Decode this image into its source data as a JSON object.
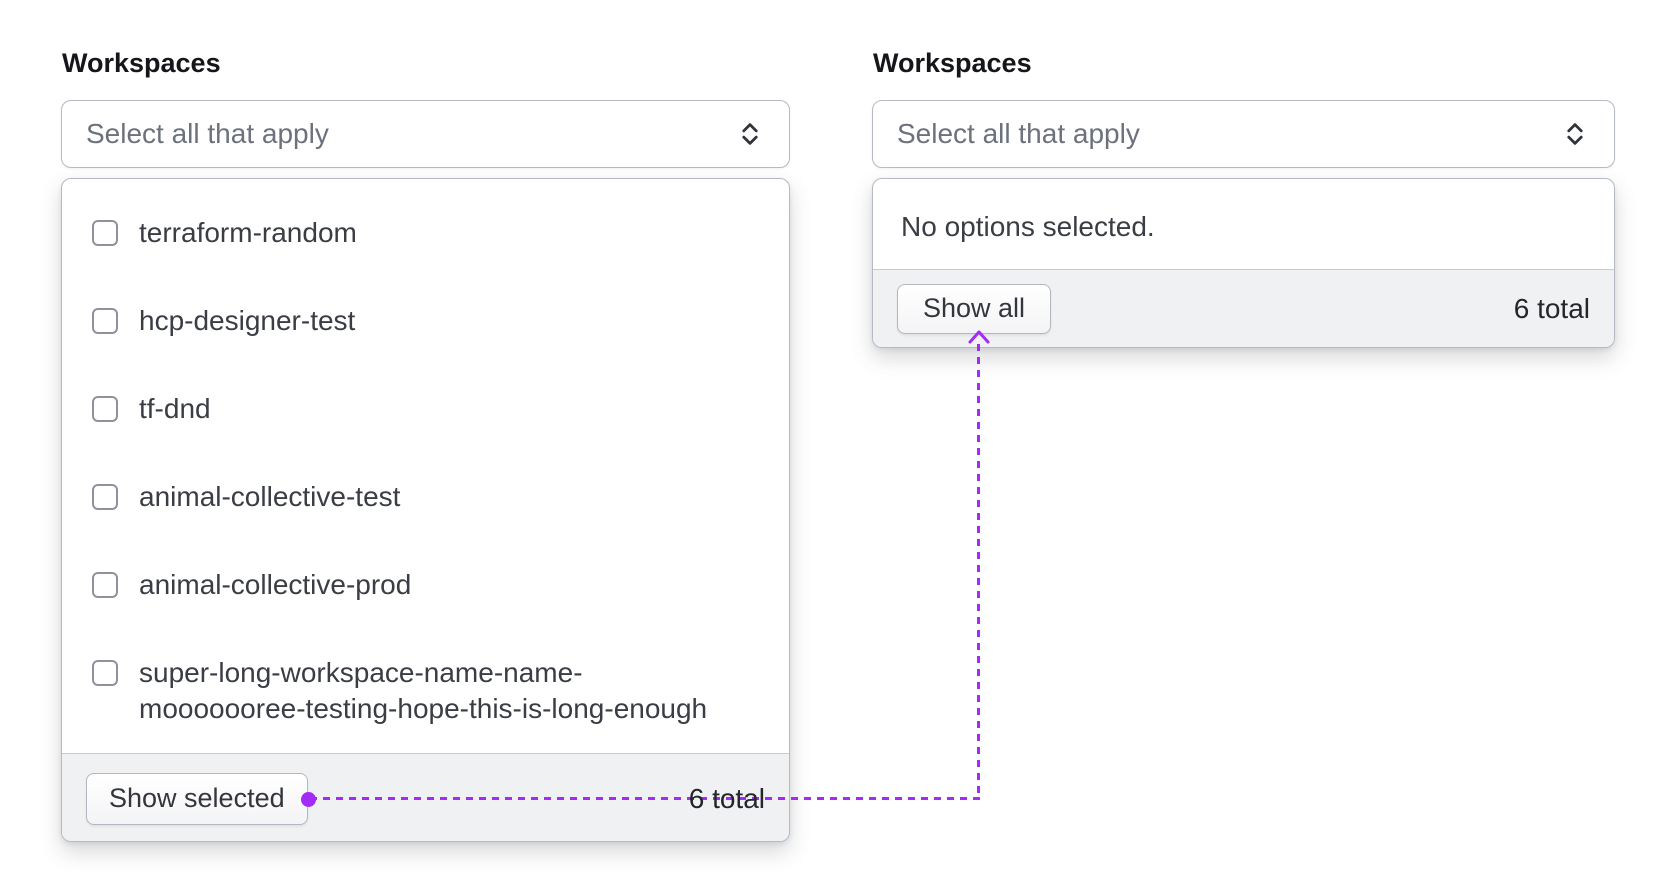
{
  "accent": {
    "purple": "#a32bf7"
  },
  "left_select": {
    "label": "Workspaces",
    "placeholder": "Select all that apply",
    "options": [
      {
        "label": "terraform-random",
        "checked": false
      },
      {
        "label": "hcp-designer-test",
        "checked": false
      },
      {
        "label": "tf-dnd",
        "checked": false
      },
      {
        "label": "animal-collective-test",
        "checked": false
      },
      {
        "label": "animal-collective-prod",
        "checked": false
      },
      {
        "label": "super-long-workspace-name-name-mooooooree-testing-hope-this-is-long-enough",
        "checked": false
      }
    ],
    "footer": {
      "button_label": "Show selected",
      "total": "6 total"
    }
  },
  "right_select": {
    "label": "Workspaces",
    "placeholder": "Select all that apply",
    "empty_message": "No options selected.",
    "footer": {
      "button_label": "Show all",
      "total": "6 total"
    }
  }
}
